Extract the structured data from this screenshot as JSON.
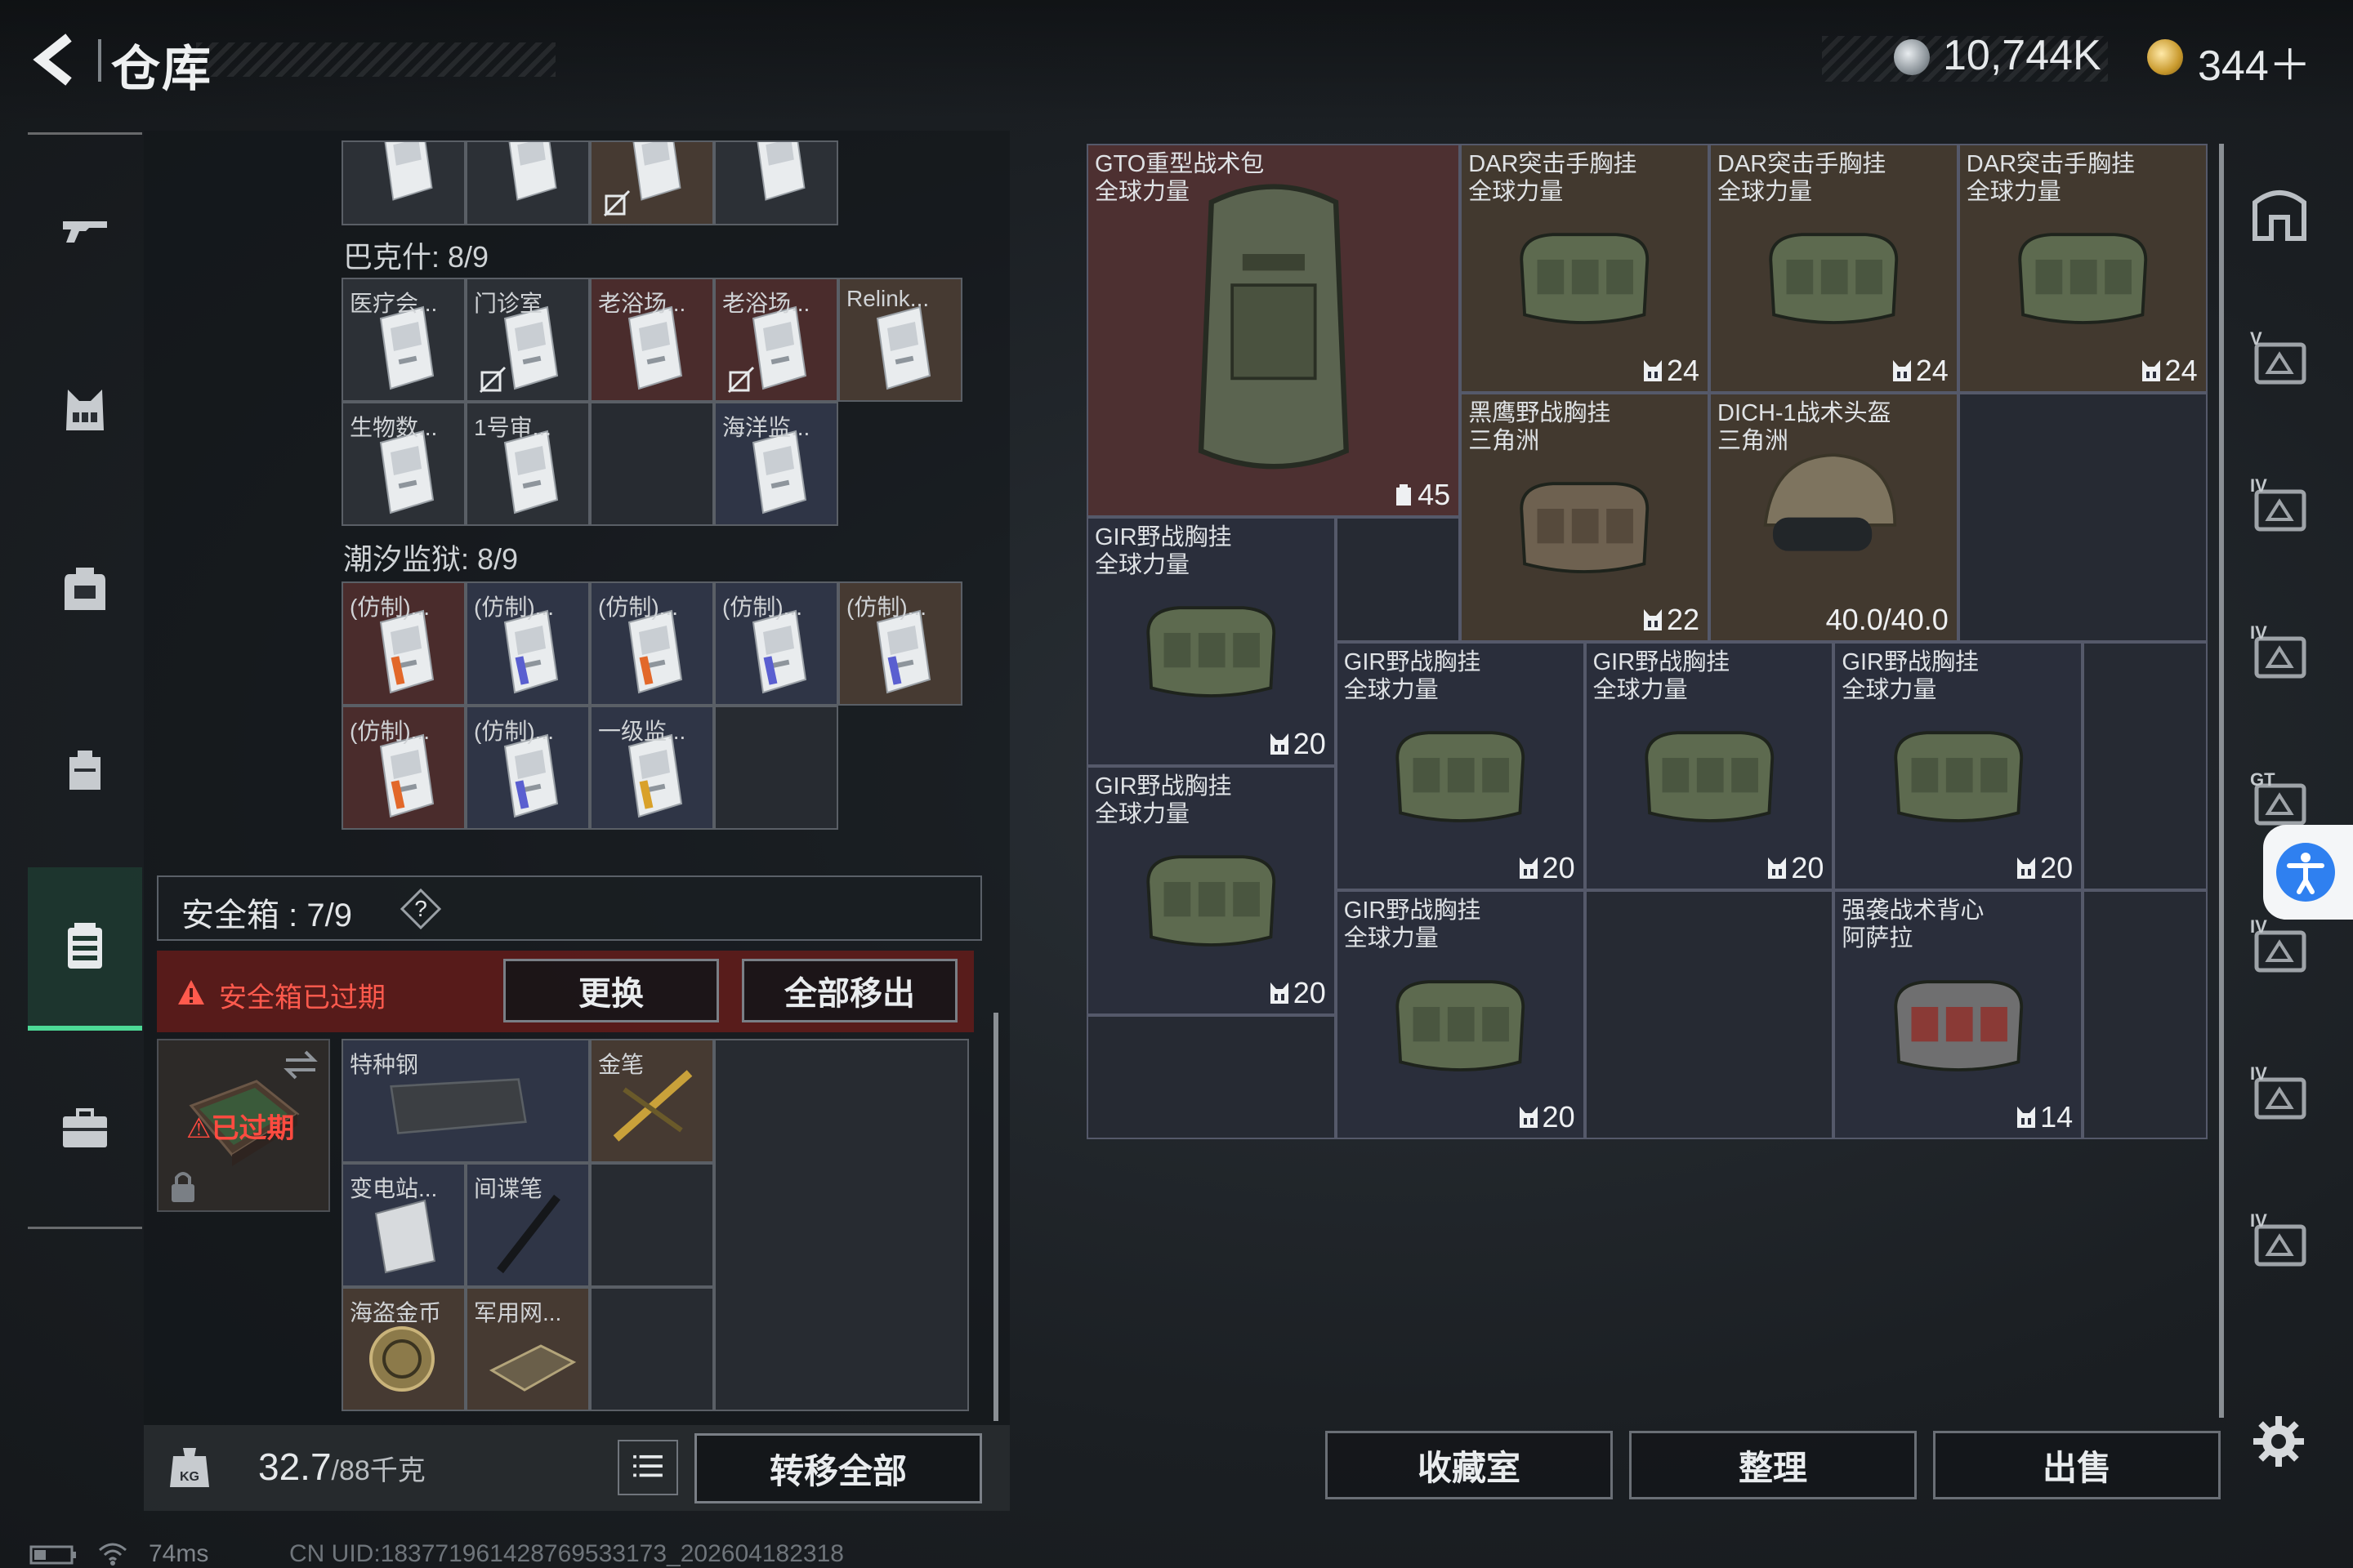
{
  "header": {
    "title": "仓库"
  },
  "currency": {
    "silver": "10,744K",
    "gold": "344＋"
  },
  "left_nav": {
    "items": [
      {
        "icon": "rifle-icon"
      },
      {
        "icon": "vest-icon"
      },
      {
        "icon": "backpack-icon"
      },
      {
        "icon": "bag-icon"
      },
      {
        "icon": "safe-case-icon",
        "active": true
      },
      {
        "icon": "briefcase-icon"
      }
    ],
    "accent_color": "#4dd996"
  },
  "keys": {
    "top_row": [
      {
        "style": "empty"
      },
      {
        "style": "empty"
      },
      {
        "style": "brown",
        "no_sell": true
      },
      {
        "style": "empty"
      }
    ],
    "bakeshi": {
      "title": "巴克什: 8/9",
      "cells": [
        {
          "label": "医疗会...",
          "style": "empty"
        },
        {
          "label": "门诊室",
          "style": "empty",
          "no_sell": true
        },
        {
          "label": "老浴场...",
          "style": "red"
        },
        {
          "label": "老浴场...",
          "style": "red",
          "no_sell": true
        },
        {
          "label": "Relink...",
          "style": "brown"
        },
        {
          "label": "生物数...",
          "style": "empty"
        },
        {
          "label": "1号审...",
          "style": "empty"
        },
        {
          "label": "",
          "style": "blank"
        },
        {
          "label": "海洋监...",
          "style": "blue"
        },
        {
          "label": "",
          "style": "none"
        }
      ]
    },
    "tidal_prison": {
      "title": "潮汐监狱: 8/9",
      "cells": [
        {
          "label": "(仿制)...",
          "style": "red"
        },
        {
          "label": "(仿制)...",
          "style": "blue"
        },
        {
          "label": "(仿制)...",
          "style": "blue"
        },
        {
          "label": "(仿制)...",
          "style": "blue"
        },
        {
          "label": "(仿制)...",
          "style": "brown"
        },
        {
          "label": "(仿制)...",
          "style": "red"
        },
        {
          "label": "(仿制)...",
          "style": "blue"
        },
        {
          "label": "一级监...",
          "style": "blue"
        },
        {
          "label": "",
          "style": "blank"
        },
        {
          "label": "",
          "style": "none"
        }
      ]
    }
  },
  "safe_box": {
    "title": "安全箱 : 7/9",
    "help": "?",
    "expired_notice": "安全箱已过期",
    "replace_label": "更换",
    "remove_all_label": "全部移出",
    "expired_badge": "已过期",
    "items": [
      {
        "label": "特种钢",
        "style": "blue"
      },
      {
        "label": "",
        "style": "blue"
      },
      {
        "label": "金笔",
        "style": "brown"
      },
      {
        "label": "变电站...",
        "style": "blue"
      },
      {
        "label": "间谍笔",
        "style": "blue"
      },
      {
        "label": "",
        "style": "blank"
      },
      {
        "label": "海盗金币",
        "style": "brown"
      },
      {
        "label": "军用网...",
        "style": "brown"
      },
      {
        "label": "",
        "style": "blank"
      }
    ]
  },
  "weight": {
    "current": "32.7",
    "capacity": "/88千克"
  },
  "transfer_all_label": "转移全部",
  "stash": {
    "items": [
      {
        "name": "GTO重型战术包",
        "sub": "全球力量",
        "qty": "45",
        "qty_icon": "backpack",
        "color": "red",
        "art": "backpack"
      },
      {
        "name": "DAR突击手胸挂",
        "sub": "全球力量",
        "qty": "24",
        "qty_icon": "vest",
        "color": "brown",
        "art": "vest"
      },
      {
        "name": "DAR突击手胸挂",
        "sub": "全球力量",
        "qty": "24",
        "qty_icon": "vest",
        "color": "brown",
        "art": "vest"
      },
      {
        "name": "DAR突击手胸挂",
        "sub": "全球力量",
        "qty": "24",
        "qty_icon": "vest",
        "color": "brown",
        "art": "vest"
      },
      {
        "name": "黑鹰野战胸挂",
        "sub": "三角洲",
        "qty": "22",
        "qty_icon": "vest",
        "color": "brown",
        "art": "vest-tan"
      },
      {
        "name": "DICH-1战术头盔",
        "sub": "三角洲",
        "qty": "40.0/40.0",
        "qty_icon": "",
        "color": "brown",
        "art": "helmet"
      },
      {
        "name": "GIR野战胸挂",
        "sub": "全球力量",
        "qty": "20",
        "qty_icon": "vest",
        "color": "blue",
        "art": "vest"
      },
      {
        "name": "GIR野战胸挂",
        "sub": "全球力量",
        "qty": "20",
        "qty_icon": "vest",
        "color": "blue",
        "art": "vest"
      },
      {
        "name": "GIR野战胸挂",
        "sub": "全球力量",
        "qty": "20",
        "qty_icon": "vest",
        "color": "blue",
        "art": "vest"
      },
      {
        "name": "GIR野战胸挂",
        "sub": "全球力量",
        "qty": "20",
        "qty_icon": "vest",
        "color": "blue",
        "art": "vest"
      },
      {
        "name": "GIR野战胸挂",
        "sub": "全球力量",
        "qty": "20",
        "qty_icon": "vest",
        "color": "blue",
        "art": "vest"
      },
      {
        "name": "GIR野战胸挂",
        "sub": "全球力量",
        "qty": "20",
        "qty_icon": "vest",
        "color": "blue",
        "art": "vest"
      },
      {
        "name": "强袭战术背心",
        "sub": "阿萨拉",
        "qty": "14",
        "qty_icon": "vest",
        "color": "blue",
        "art": "vest-red"
      }
    ]
  },
  "right_tools": [
    {
      "icon": "stash-home-icon",
      "tag": ""
    },
    {
      "icon": "stash-page-icon",
      "tag": "V"
    },
    {
      "icon": "stash-page-icon",
      "tag": "IV"
    },
    {
      "icon": "stash-page-icon",
      "tag": "IV"
    },
    {
      "icon": "stash-page-icon",
      "tag": "GT"
    },
    {
      "icon": "stash-page-icon",
      "tag": "IV"
    },
    {
      "icon": "stash-page-icon",
      "tag": "IV"
    },
    {
      "icon": "stash-page-icon",
      "tag": "IV"
    }
  ],
  "bottom_buttons": {
    "collection": "收藏室",
    "organize": "整理",
    "sell": "出售"
  },
  "status": {
    "ping": "74ms",
    "uid": "CN UID:1837719614287695331​73_202604182318"
  }
}
